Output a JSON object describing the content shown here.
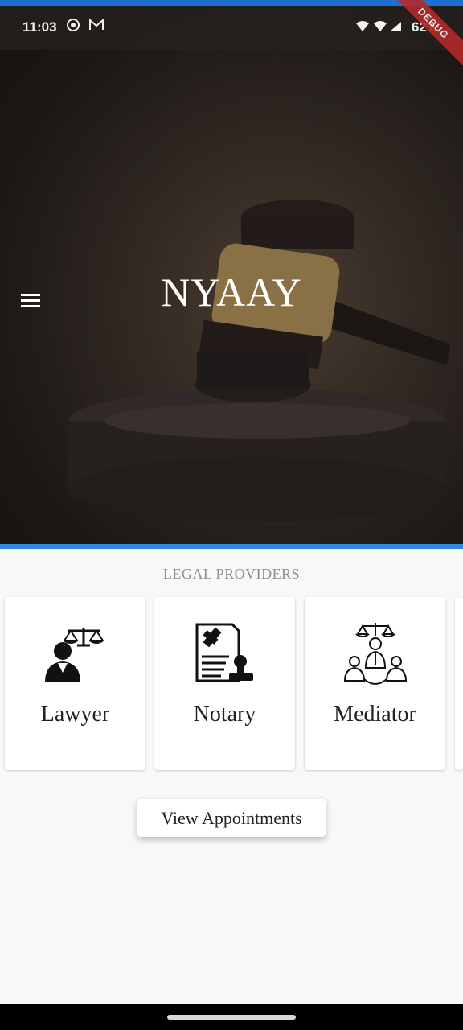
{
  "status_bar": {
    "time": "11:03",
    "battery": "62%"
  },
  "debug_banner": "DEBUG",
  "header": {
    "title": "NYAAY"
  },
  "section": {
    "title": "LEGAL PROVIDERS"
  },
  "providers": [
    {
      "label": "Lawyer",
      "icon": "lawyer-scales-icon"
    },
    {
      "label": "Notary",
      "icon": "notary-document-stamp-icon"
    },
    {
      "label": "Mediator",
      "icon": "mediator-group-scales-icon"
    }
  ],
  "actions": {
    "view_appointments": "View Appointments"
  },
  "colors": {
    "accent": "#2e86e6",
    "top_strip": "#1f6fd1",
    "debug": "#b22a2a"
  }
}
